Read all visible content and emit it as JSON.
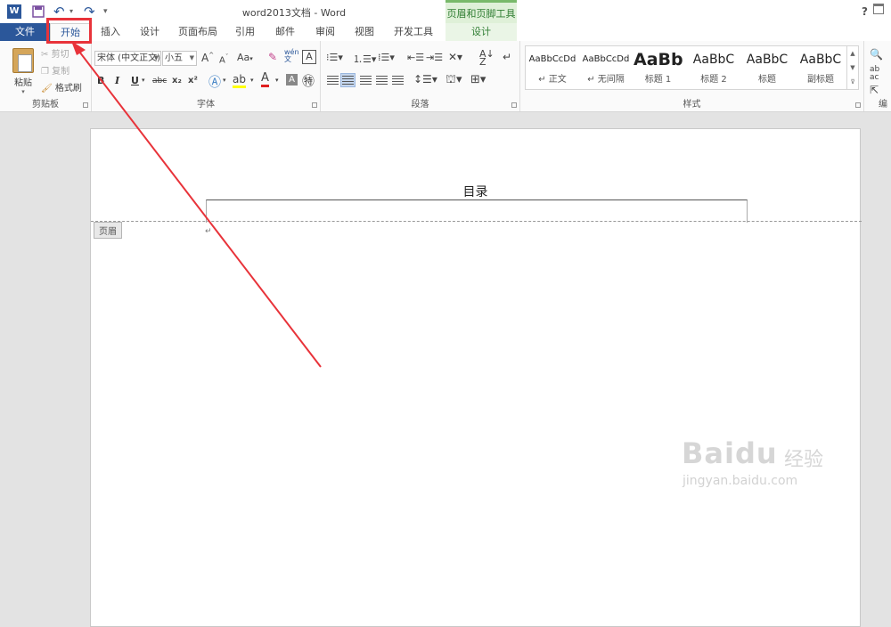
{
  "title_bar": {
    "word_logo_text": "W",
    "doc_title": "word2013文档 - Word",
    "contextual_header": "页眉和页脚工具",
    "help": "?"
  },
  "tabs": [
    {
      "label": "文件"
    },
    {
      "label": "开始"
    },
    {
      "label": "插入"
    },
    {
      "label": "设计"
    },
    {
      "label": "页面布局"
    },
    {
      "label": "引用"
    },
    {
      "label": "邮件"
    },
    {
      "label": "审阅"
    },
    {
      "label": "视图"
    },
    {
      "label": "开发工具"
    },
    {
      "label": "设计"
    }
  ],
  "clipboard": {
    "paste": "粘贴",
    "cut": "剪切",
    "copy": "复制",
    "format_painter": "格式刷",
    "group_label": "剪贴板"
  },
  "font": {
    "font_name": "宋体 (中文正文)",
    "font_size": "小五",
    "change_case": "Aa",
    "bold": "B",
    "italic": "I",
    "underline": "U",
    "strikethrough": "abc",
    "subscript": "x₂",
    "superscript": "x²",
    "group_label": "字体"
  },
  "paragraph": {
    "group_label": "段落"
  },
  "styles": {
    "items": [
      {
        "sample": "AaBbCcDd",
        "name": "↵ 正文"
      },
      {
        "sample": "AaBbCcDd",
        "name": "↵ 无间隔"
      },
      {
        "sample": "AaBb",
        "name": "标题 1"
      },
      {
        "sample": "AaBbC",
        "name": "标题 2"
      },
      {
        "sample": "AaBbC",
        "name": "标题"
      },
      {
        "sample": "AaBbC",
        "name": "副标题"
      }
    ],
    "group_label": "样式"
  },
  "editing": {
    "group_label": "编"
  },
  "document": {
    "header_text": "目录",
    "header_tag": "页眉",
    "watermark_logo": "Baidu",
    "watermark_cn": "经验",
    "watermark_url": "jingyan.baidu.com"
  },
  "colors": {
    "accent": "#2b579a",
    "annotation": "#e8333a",
    "contextual": "#78b96a"
  }
}
